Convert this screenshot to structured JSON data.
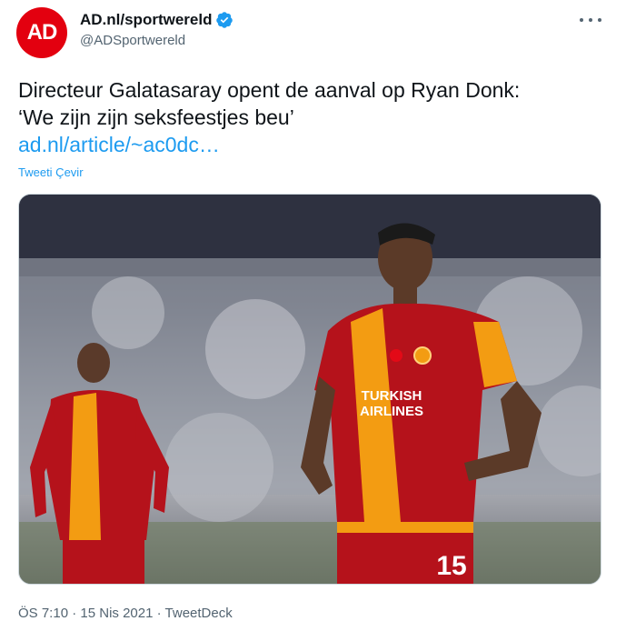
{
  "account": {
    "display_name": "AD.nl/sportwereld",
    "handle": "@ADSportwereld",
    "avatar_text": "AD",
    "verified_icon": "verified-badge-icon",
    "brand_color": "#e3000f"
  },
  "tweet": {
    "line1": "Directeur Galatasaray opent de aanval op Ryan Donk:",
    "line2": "‘We zijn zijn seksfeestjes beu’",
    "link": "ad.nl/article/~ac0dc…",
    "translate_label": "Tweeti Çevir"
  },
  "media": {
    "shirt_sponsor_line1": "TURKISH",
    "shirt_sponsor_line2": "AIRLINES",
    "shirt_number": "15"
  },
  "meta": {
    "time": "ÖS 7:10",
    "separator1": "·",
    "date": "15 Nis 2021",
    "separator2": "·",
    "source": "TweetDeck"
  },
  "colors": {
    "link": "#1d9bf0",
    "secondary_text": "#536471",
    "jersey_red": "#b5121b",
    "jersey_orange": "#f39c12"
  }
}
